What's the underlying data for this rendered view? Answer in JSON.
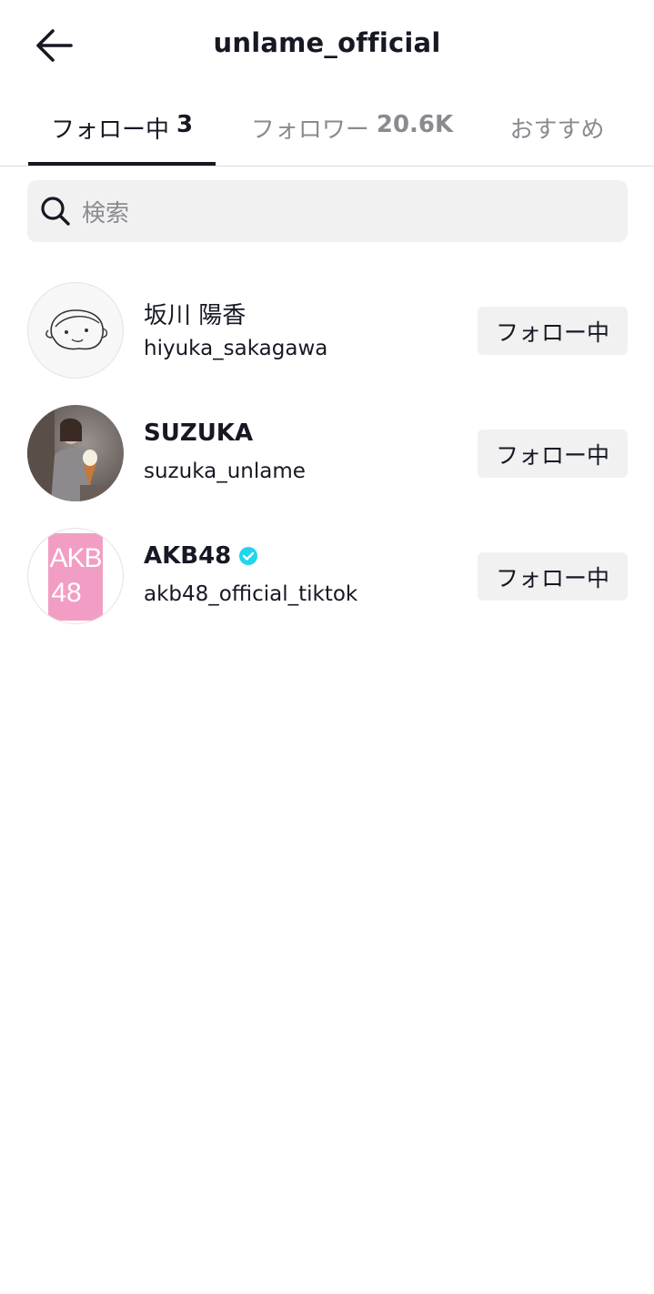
{
  "header": {
    "title": "unlame_official",
    "back_icon": "arrow-left-icon"
  },
  "tabs": [
    {
      "label": "フォロー中",
      "count": "3",
      "active": true
    },
    {
      "label": "フォロワー",
      "count": "20.6K",
      "active": false
    },
    {
      "label": "おすすめ",
      "count": "",
      "active": false
    }
  ],
  "search": {
    "placeholder": "検索",
    "icon": "search-icon"
  },
  "following": [
    {
      "name": "坂川 陽香",
      "handle": "hiyuka_sakagawa",
      "button": "フォロー中",
      "verified": false,
      "avatar": "line-drawing-face"
    },
    {
      "name": "SUZUKA",
      "handle": "suzuka_unlame",
      "button": "フォロー中",
      "verified": false,
      "avatar": "photo-person-ice-cream"
    },
    {
      "name": "AKB48",
      "handle": "akb48_official_tiktok",
      "button": "フォロー中",
      "verified": true,
      "avatar": "akb48-pink-logo"
    }
  ],
  "colors": {
    "text": "#161823",
    "muted": "#8a8b91",
    "button_bg": "#f1f1f2",
    "verified": "#20d5ec",
    "akb_pink": "#f29ec4"
  }
}
